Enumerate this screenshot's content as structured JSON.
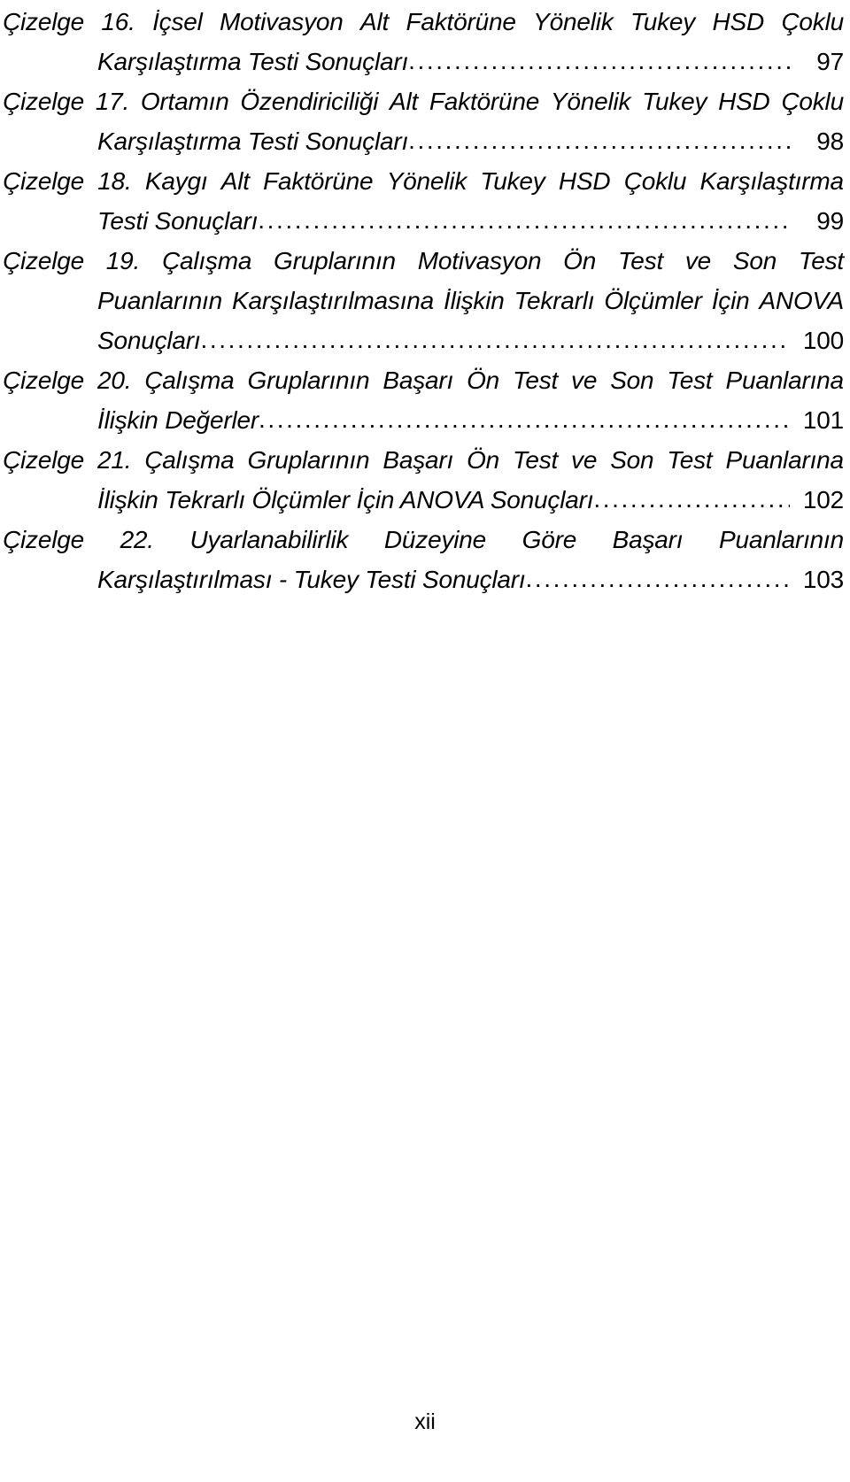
{
  "document": {
    "type": "thesis-list-of-tables",
    "language": "tr",
    "folio": "xii",
    "label_word": "Çizelge"
  },
  "entries": [
    {
      "number": "16",
      "label": "Çizelge 16.",
      "title": "İçsel Motivasyon Alt Faktörüne Yönelik Tukey HSD Çoklu Karşılaştırma Testi Sonuçları",
      "page": "97",
      "lines": [
        {
          "style": "first-justify",
          "words": [
            "Çizelge",
            "16.",
            "İçsel",
            "Motivasyon",
            "Alt",
            "Faktörüne",
            "Yönelik",
            "Tukey",
            "HSD",
            "Çoklu"
          ]
        },
        {
          "style": "cont-leader",
          "text": "Karşılaştırma Testi Sonuçları",
          "page": "97"
        }
      ]
    },
    {
      "number": "17",
      "label": "Çizelge 17.",
      "title": "Ortamın Özendiriciliği Alt Faktörüne Yönelik Tukey HSD Çoklu Karşılaştırma Testi Sonuçları",
      "page": "98",
      "lines": [
        {
          "style": "first-justify",
          "words": [
            "Çizelge",
            "17.",
            "Ortamın",
            "Özendiriciliği",
            "Alt",
            "Faktörüne",
            "Yönelik",
            "Tukey",
            "HSD",
            "Çoklu"
          ]
        },
        {
          "style": "cont-leader",
          "text": "Karşılaştırma Testi Sonuçları",
          "page": "98"
        }
      ]
    },
    {
      "number": "18",
      "label": "Çizelge 18.",
      "title": "Kaygı Alt Faktörüne Yönelik Tukey HSD Çoklu Karşılaştırma Testi Sonuçları",
      "page": "99",
      "lines": [
        {
          "style": "first-justify",
          "words": [
            "Çizelge",
            "18.",
            "Kaygı",
            "Alt",
            "Faktörüne",
            "Yönelik",
            "Tukey",
            "HSD",
            "Çoklu",
            "Karşılaştırma"
          ]
        },
        {
          "style": "cont-leader",
          "text": "Testi Sonuçları",
          "page": "99"
        }
      ]
    },
    {
      "number": "19",
      "label": "Çizelge 19.",
      "title": "Çalışma Gruplarının Motivasyon Ön Test ve Son Test Puanlarının Karşılaştırılmasına İlişkin Tekrarlı Ölçümler İçin ANOVA Sonuçları",
      "page": "100",
      "lines": [
        {
          "style": "first-justify",
          "words": [
            "Çizelge",
            "19.",
            "Çalışma",
            "Gruplarının",
            "Motivasyon",
            "Ön",
            "Test",
            "ve",
            "Son",
            "Test"
          ]
        },
        {
          "style": "cont-justify",
          "words": [
            "Puanlarının",
            "Karşılaştırılmasına",
            "İlişkin",
            "Tekrarlı",
            "Ölçümler",
            "İçin",
            "ANOVA"
          ]
        },
        {
          "style": "cont-leader",
          "text": "Sonuçları",
          "page": "100"
        }
      ]
    },
    {
      "number": "20",
      "label": "Çizelge 20.",
      "title": "Çalışma Gruplarının Başarı Ön Test ve Son Test Puanlarına İlişkin Değerler",
      "page": "101",
      "lines": [
        {
          "style": "first-justify",
          "words": [
            "Çizelge",
            "20.",
            "Çalışma",
            "Gruplarının",
            "Başarı",
            "Ön",
            "Test",
            "ve",
            "Son",
            "Test",
            "Puanlarına"
          ]
        },
        {
          "style": "cont-leader",
          "text": "İlişkin Değerler",
          "page": "101"
        }
      ]
    },
    {
      "number": "21",
      "label": "Çizelge 21.",
      "title": "Çalışma Gruplarının Başarı Ön Test ve Son Test Puanlarına İlişkin Tekrarlı Ölçümler İçin ANOVA Sonuçları",
      "page": "102",
      "lines": [
        {
          "style": "first-justify",
          "words": [
            "Çizelge",
            "21.",
            "Çalışma",
            "Gruplarının",
            "Başarı",
            "Ön",
            "Test",
            "ve",
            "Son",
            "Test",
            "Puanlarına"
          ]
        },
        {
          "style": "cont-leader",
          "text": "İlişkin Tekrarlı Ölçümler İçin ANOVA Sonuçları",
          "page": "102"
        }
      ]
    },
    {
      "number": "22",
      "label": "Çizelge 22.",
      "title": "Uyarlanabilirlik Düzeyine Göre Başarı Puanlarının Karşılaştırılması - Tukey Testi Sonuçları",
      "page": "103",
      "lines": [
        {
          "style": "first-justify",
          "words": [
            "Çizelge",
            "22.",
            "Uyarlanabilirlik",
            "Düzeyine",
            "Göre",
            "Başarı",
            "Puanlarının"
          ]
        },
        {
          "style": "cont-leader",
          "text": "Karşılaştırılması - Tukey Testi Sonuçları",
          "page": "103"
        }
      ]
    }
  ]
}
